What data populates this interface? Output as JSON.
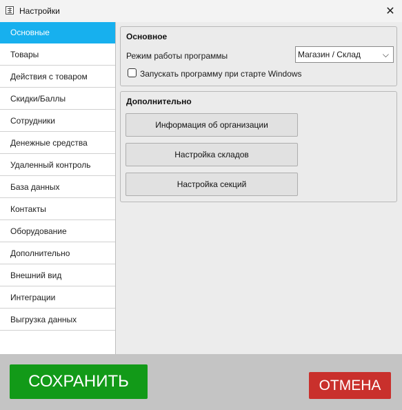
{
  "window": {
    "title": "Настройки",
    "close_glyph": "✕"
  },
  "sidebar": {
    "items": [
      {
        "label": "Основные"
      },
      {
        "label": "Товары"
      },
      {
        "label": "Действия с товаром"
      },
      {
        "label": "Скидки/Баллы"
      },
      {
        "label": "Сотрудники"
      },
      {
        "label": "Денежные средства"
      },
      {
        "label": "Удаленный контроль"
      },
      {
        "label": "База данных"
      },
      {
        "label": "Контакты"
      },
      {
        "label": "Оборудование"
      },
      {
        "label": "Дополнительно"
      },
      {
        "label": "Внешний вид"
      },
      {
        "label": "Интеграции"
      },
      {
        "label": "Выгрузка данных"
      }
    ],
    "active_index": 0
  },
  "main": {
    "basic": {
      "title": "Основное",
      "mode_label": "Режим работы программы",
      "mode_value": "Магазин / Склад",
      "autostart_label": "Запускать программу при старте Windows",
      "autostart_checked": false
    },
    "additional": {
      "title": "Дополнительно",
      "buttons": {
        "org_info": "Информация об организации",
        "warehouses": "Настройка складов",
        "sections": "Настройка секций"
      }
    }
  },
  "footer": {
    "save_label": "СОХРАНИТЬ",
    "cancel_label": "ОТМЕНА"
  },
  "colors": {
    "active_nav": "#17b0ee",
    "save": "#129a18",
    "cancel": "#c9302c"
  }
}
